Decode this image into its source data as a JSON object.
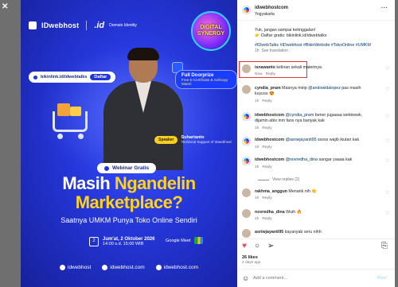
{
  "poster": {
    "brand": "IDwebhost",
    "brand_secondary": ".id",
    "brand_secondary_sub": "Domain Identity",
    "badge_text": "DIGITAL SYNERGY",
    "link": "bikinlink.id/idwebtalks",
    "link_button": "Daftar",
    "promo_title": "Full Doorprize",
    "promo_sub": "Free E-Certificate & Softcopy Materi",
    "speaker_tag": "Speaker",
    "speaker_name": "Suhartanto",
    "speaker_role": "Technical Support of IDwebhost",
    "webinar_label": "Webinar Gratis",
    "title_white": "Masih",
    "title_yellow_1": "Ngandelin",
    "title_yellow_2": "Marketplace?",
    "subtitle": "Saatnya UMKM Punya Toko Online Sendiri",
    "event_date": "Jum'at, 2 Oktober 2026",
    "event_time": "14:00 s.d. 15:00 WIB",
    "cal_day": "2",
    "meet_label": "Google Meet",
    "footer_1": "idwebhost",
    "footer_2": "idwebhost.com",
    "footer_3": "idwebhost.com"
  },
  "panel": {
    "username": "idwebhostcom",
    "location": "Yogyakarta",
    "more": "···",
    "caption_1": "Yuk, jangan sampai ketinggalan!",
    "caption_2": "👉 Daftar gratis: bikinlink.id/idwebtalks",
    "caption_tags": "#IDwebTalks #IDwebhost #BikinWebsite #TokoOnline #UMKM",
    "caption_age": "1h",
    "caption_see": "See translation",
    "comments": [
      {
        "user": "isnawanto",
        "text": "kelinan sekali materinya",
        "age": "Now",
        "reply": "Reply"
      },
      {
        "user": "cyndia_pram",
        "text": "Masnya mirip",
        "mention": "@andowidalopez",
        "text2": "pas masih kuyuss 😍",
        "age": "1h",
        "reply": "Reply"
      },
      {
        "user": "idwebhostcom",
        "mention": "@cyndia_pram",
        "text": "bener jugaaaa wekkwwk, dijamin abis inm fans nya banyak kak",
        "age": "1h",
        "reply": "Reply"
      },
      {
        "user": "idwebhostcom",
        "mention": "@asriwjayanti95",
        "text": "sssss wajib ikutan kak",
        "age": "1h",
        "reply": "Reply"
      },
      {
        "user": "idwebhostcom",
        "mention": "@novredha_dina",
        "text": "sangar yaaaa kak",
        "age": "1h",
        "reply": "Reply"
      },
      {
        "user": "rakhma_anggun",
        "text": "Menarik nih 👏",
        "age": "1h",
        "reply": "Reply"
      },
      {
        "user": "novredha_dina",
        "text": "Wuih 🔥",
        "age": "1h",
        "reply": "Reply"
      },
      {
        "user": "asriwjayanti95",
        "text": "kayanyab seru nihh",
        "age": "",
        "reply": ""
      }
    ],
    "view_replies": "View replies (2)",
    "likes": "26 likes",
    "posted": "2 days ago",
    "add_comment_placeholder": "Add a comment...",
    "post_label": "Post"
  },
  "colors": {
    "poster_bg": "#2436d8",
    "accent_yellow": "#ffd21f",
    "highlight_border": "#e5353b",
    "link_blue": "#00376b"
  }
}
